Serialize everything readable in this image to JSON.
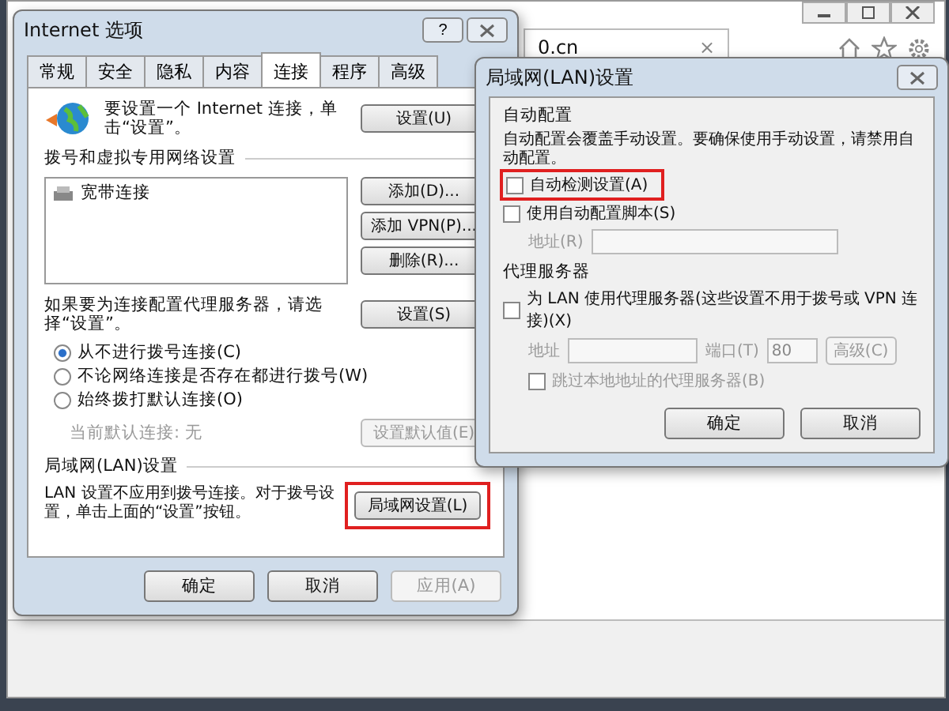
{
  "browser": {
    "tab": {
      "title": "0.cn",
      "close": "×"
    }
  },
  "options_dialog": {
    "title": "Internet 选项",
    "help": "?",
    "tabs": [
      {
        "label": "常规",
        "selected": false
      },
      {
        "label": "安全",
        "selected": false
      },
      {
        "label": "隐私",
        "selected": false
      },
      {
        "label": "内容",
        "selected": false
      },
      {
        "label": "连接",
        "selected": true
      },
      {
        "label": "程序",
        "selected": false
      },
      {
        "label": "高级",
        "selected": false
      }
    ],
    "setup": {
      "text": "要设置一个 Internet 连接，单击“设置”。",
      "button": "设置(U)"
    },
    "dialup": {
      "heading": "拨号和虚拟专用网络设置",
      "connections": [
        "宽带连接"
      ],
      "buttons": [
        "添加(D)...",
        "添加 VPN(P)...",
        "删除(R)..."
      ]
    },
    "proxy": {
      "text": "如果要为连接配置代理服务器，请选择“设置”。",
      "button": "设置(S)"
    },
    "dial_options": [
      {
        "label": "从不进行拨号连接(C)",
        "selected": true
      },
      {
        "label": "不论网络连接是否存在都进行拨号(W)",
        "selected": false
      },
      {
        "label": "始终拨打默认连接(O)",
        "selected": false
      }
    ],
    "default_connection": {
      "label": "当前默认连接:  无",
      "disabled": true,
      "button": "设置默认值(E)"
    },
    "lan": {
      "heading": "局域网(LAN)设置",
      "text": "LAN 设置不应用到拨号连接。对于拨号设置，单击上面的“设置”按钮。",
      "button": {
        "label": "局域网设置(L)",
        "highlighted": true
      }
    },
    "buttons": [
      {
        "label": "确定",
        "disabled": false
      },
      {
        "label": "取消",
        "disabled": false
      },
      {
        "label": "应用(A)",
        "disabled": true
      }
    ]
  },
  "lan_dialog": {
    "title": "局域网(LAN)设置",
    "auto_config": {
      "heading": "自动配置",
      "text": "自动配置会覆盖手动设置。要确保使用手动设置，请禁用自动配置。",
      "options": [
        {
          "label": "自动检测设置(A)",
          "checked": false,
          "highlighted": true
        },
        {
          "label": "使用自动配置脚本(S)",
          "checked": false,
          "highlighted": false
        }
      ],
      "address_label": "地址(R)"
    },
    "proxy": {
      "heading": "代理服务器",
      "option": {
        "label": "为 LAN 使用代理服务器(这些设置不用于拨号或 VPN 连接)(X)",
        "checked": false
      },
      "address_label": "地址",
      "port_label": "端口(T)",
      "port_value": "80",
      "advanced_button": "高级(C)",
      "bypass": {
        "label": "跳过本地地址的代理服务器(B)",
        "checked": false
      }
    },
    "buttons": [
      "确定",
      "取消"
    ]
  }
}
